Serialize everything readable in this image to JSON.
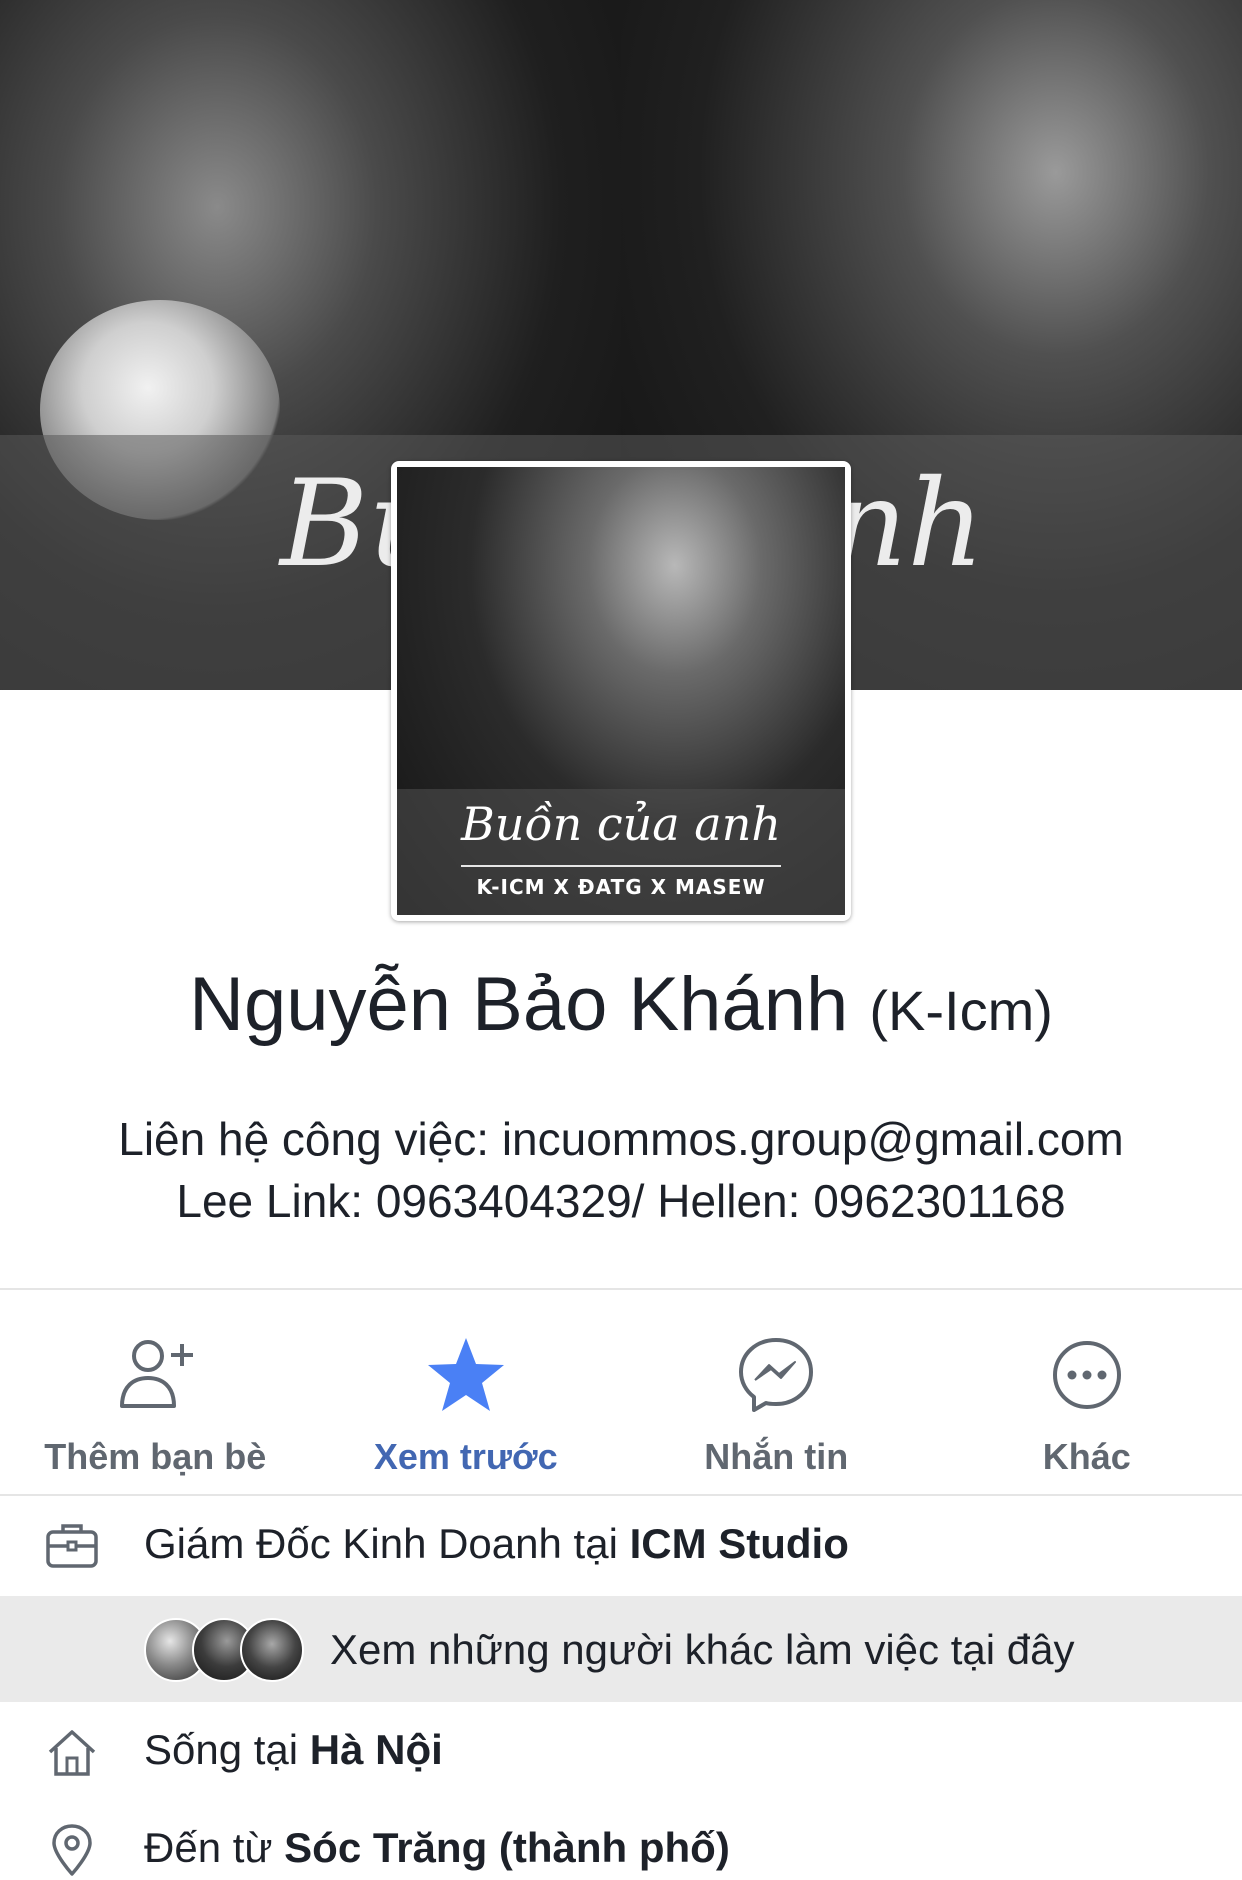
{
  "cover": {
    "script_left": "Bu",
    "script_right": "nh"
  },
  "profile_picture": {
    "title": "Buồn của anh",
    "subtitle": "K-ICM X ĐATG X MASEW"
  },
  "profile": {
    "name": "Nguyễn Bảo Khánh",
    "alt_name": "(K-Icm)",
    "bio_line1": "Liên hệ công việc: incuommos.group@gmail.com",
    "bio_line2": "Lee Link: 0963404329/ Hellen: 0962301168"
  },
  "actions": [
    {
      "label": "Thêm bạn bè",
      "icon": "add-friend-icon"
    },
    {
      "label": "Xem trước",
      "icon": "star-icon",
      "active": true
    },
    {
      "label": "Nhắn tin",
      "icon": "messenger-icon"
    },
    {
      "label": "Khác",
      "icon": "more-icon"
    }
  ],
  "info": {
    "work": {
      "prefix": "Giám Đốc Kinh Doanh tại ",
      "place": "ICM Studio",
      "icon": "briefcase-icon"
    },
    "coworkers": {
      "label": "Xem những người khác làm việc tại đây"
    },
    "lives": {
      "prefix": "Sống tại ",
      "place": "Hà Nội",
      "icon": "home-icon"
    },
    "from": {
      "prefix": "Đến từ ",
      "place": "Sóc Trăng (thành phố)",
      "icon": "location-pin-icon"
    }
  },
  "colors": {
    "accent": "#4267b2",
    "star": "#4a80f5",
    "muted_label": "#606770",
    "highlight_row": "#eaeaea"
  }
}
